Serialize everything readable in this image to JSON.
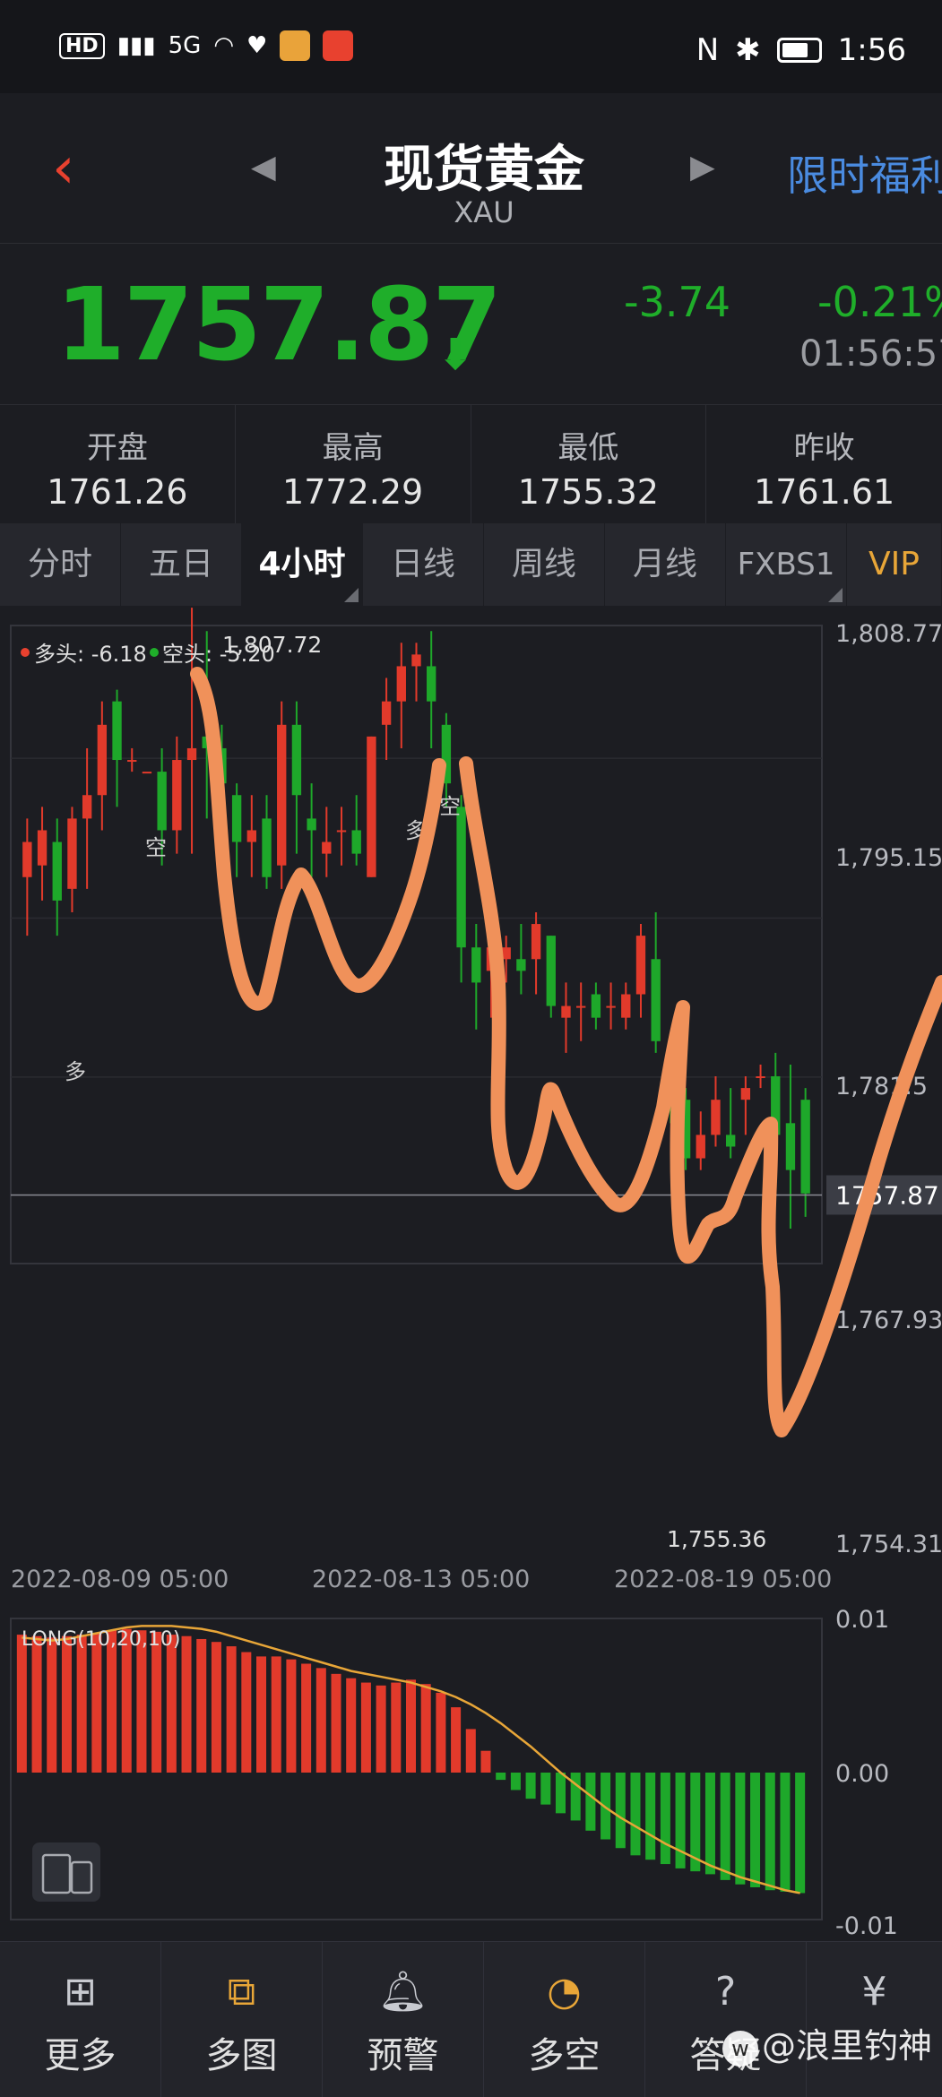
{
  "status_bar": {
    "left_chip": "HD",
    "left_chip_sub": "2",
    "signal_text": "5G",
    "time": "1:56",
    "right_icons": [
      "nfc-icon",
      "bluetooth-icon",
      "battery-icon"
    ]
  },
  "header": {
    "back_icon": "chevron-left-icon",
    "title": "现货黄金",
    "subtitle": "XAU",
    "promo_text": "限时福利"
  },
  "quote": {
    "price": "1757.87",
    "change": "-3.74",
    "percent": "-0.21%",
    "time": "01:56:57",
    "color_down": "#1fae2a",
    "color_up": "#e8412f"
  },
  "stats": [
    {
      "label": "开盘",
      "value": "1761.26"
    },
    {
      "label": "最高",
      "value": "1772.29"
    },
    {
      "label": "最低",
      "value": "1755.32"
    },
    {
      "label": "昨收",
      "value": "1761.61"
    }
  ],
  "tabs": [
    {
      "label": "分时",
      "active": false
    },
    {
      "label": "五日",
      "active": false
    },
    {
      "label": "4小时",
      "active": true
    },
    {
      "label": "日线",
      "active": false
    },
    {
      "label": "周线",
      "active": false
    },
    {
      "label": "月线",
      "active": false
    },
    {
      "label": "FXBS1",
      "active": false
    },
    {
      "label": "VIP",
      "active": false
    }
  ],
  "chart": {
    "legend_long": "多头: -6.18",
    "legend_short": "空头: -5.20",
    "high_label": "1,807.72",
    "low_label": "1,755.36",
    "current_price_label": "1757.87",
    "y_ticks": [
      "1,808.77",
      "1,795.15",
      "1,781.5",
      "1,767.93",
      "1,754.31"
    ],
    "x_ticks": [
      "2022-08-09 05:00",
      "2022-08-13 05:00",
      "2022-08-19 05:00"
    ],
    "signals": [
      {
        "text": "多"
      },
      {
        "text": "空"
      },
      {
        "text": "多"
      },
      {
        "text": "空"
      }
    ],
    "indicator_label": "LONG(10,20,10)",
    "indicator_ticks": [
      "0.01",
      "0.00",
      "-0.01"
    ]
  },
  "chart_data": {
    "type": "candlestick",
    "y_range": [
      1754.31,
      1808.77
    ],
    "candles": [
      {
        "o": 1785,
        "c": 1788,
        "h": 1790,
        "l": 1780
      },
      {
        "o": 1786,
        "c": 1789,
        "h": 1791,
        "l": 1783
      },
      {
        "o": 1788,
        "c": 1783,
        "h": 1790,
        "l": 1780
      },
      {
        "o": 1784,
        "c": 1790,
        "h": 1791,
        "l": 1782
      },
      {
        "o": 1790,
        "c": 1792,
        "h": 1796,
        "l": 1784
      },
      {
        "o": 1792,
        "c": 1798,
        "h": 1800,
        "l": 1789
      },
      {
        "o": 1800,
        "c": 1795,
        "h": 1801,
        "l": 1791
      },
      {
        "o": 1795,
        "c": 1795,
        "h": 1796,
        "l": 1794
      },
      {
        "o": 1794,
        "c": 1794,
        "h": 1794,
        "l": 1794
      },
      {
        "o": 1794,
        "c": 1789,
        "h": 1796,
        "l": 1786
      },
      {
        "o": 1789,
        "c": 1795,
        "h": 1797,
        "l": 1787
      },
      {
        "o": 1795,
        "c": 1796,
        "h": 1808,
        "l": 1787
      },
      {
        "o": 1797,
        "c": 1796,
        "h": 1806,
        "l": 1790
      },
      {
        "o": 1796,
        "c": 1793,
        "h": 1798,
        "l": 1787
      },
      {
        "o": 1792,
        "c": 1788,
        "h": 1793,
        "l": 1785
      },
      {
        "o": 1788,
        "c": 1789,
        "h": 1792,
        "l": 1785
      },
      {
        "o": 1790,
        "c": 1785,
        "h": 1792,
        "l": 1784
      },
      {
        "o": 1786,
        "c": 1798,
        "h": 1800,
        "l": 1784
      },
      {
        "o": 1798,
        "c": 1792,
        "h": 1800,
        "l": 1787
      },
      {
        "o": 1790,
        "c": 1789,
        "h": 1793,
        "l": 1785
      },
      {
        "o": 1787,
        "c": 1788,
        "h": 1791,
        "l": 1785
      },
      {
        "o": 1789,
        "c": 1789,
        "h": 1791,
        "l": 1786
      },
      {
        "o": 1789,
        "c": 1787,
        "h": 1792,
        "l": 1786
      },
      {
        "o": 1785,
        "c": 1797,
        "h": 1797,
        "l": 1785
      },
      {
        "o": 1798,
        "c": 1800,
        "h": 1802,
        "l": 1795
      },
      {
        "o": 1800,
        "c": 1803,
        "h": 1805,
        "l": 1796
      },
      {
        "o": 1803,
        "c": 1804,
        "h": 1805,
        "l": 1800
      },
      {
        "o": 1803,
        "c": 1800,
        "h": 1806,
        "l": 1796
      },
      {
        "o": 1798,
        "c": 1793,
        "h": 1799,
        "l": 1791
      },
      {
        "o": 1791,
        "c": 1779,
        "h": 1792,
        "l": 1776
      },
      {
        "o": 1779,
        "c": 1776,
        "h": 1781,
        "l": 1772
      },
      {
        "o": 1777,
        "c": 1779,
        "h": 1779,
        "l": 1773
      },
      {
        "o": 1778,
        "c": 1779,
        "h": 1780,
        "l": 1776
      },
      {
        "o": 1778,
        "c": 1777,
        "h": 1781,
        "l": 1775
      },
      {
        "o": 1778,
        "c": 1781,
        "h": 1782,
        "l": 1775
      },
      {
        "o": 1780,
        "c": 1774,
        "h": 1780,
        "l": 1773
      },
      {
        "o": 1773,
        "c": 1774,
        "h": 1776,
        "l": 1770
      },
      {
        "o": 1774,
        "c": 1774,
        "h": 1776,
        "l": 1771
      },
      {
        "o": 1775,
        "c": 1773,
        "h": 1776,
        "l": 1772
      },
      {
        "o": 1774,
        "c": 1774,
        "h": 1776,
        "l": 1772
      },
      {
        "o": 1773,
        "c": 1775,
        "h": 1776,
        "l": 1772
      },
      {
        "o": 1775,
        "c": 1780,
        "h": 1781,
        "l": 1773
      },
      {
        "o": 1778,
        "c": 1771,
        "h": 1782,
        "l": 1770
      },
      {
        "o": 1770,
        "c": 1766,
        "h": 1770,
        "l": 1764
      },
      {
        "o": 1766,
        "c": 1761,
        "h": 1767,
        "l": 1760
      },
      {
        "o": 1761,
        "c": 1763,
        "h": 1765,
        "l": 1760
      },
      {
        "o": 1763,
        "c": 1766,
        "h": 1768,
        "l": 1762
      },
      {
        "o": 1763,
        "c": 1762,
        "h": 1767,
        "l": 1761
      },
      {
        "o": 1766,
        "c": 1767,
        "h": 1768,
        "l": 1763
      },
      {
        "o": 1768,
        "c": 1768,
        "h": 1769,
        "l": 1767
      },
      {
        "o": 1768,
        "c": 1763,
        "h": 1770,
        "l": 1761
      },
      {
        "o": 1764,
        "c": 1760,
        "h": 1769,
        "l": 1755
      },
      {
        "o": 1766,
        "c": 1758,
        "h": 1767,
        "l": 1756
      }
    ],
    "indicator": {
      "bars": [
        0.0095,
        0.0094,
        0.0093,
        0.0094,
        0.0095,
        0.0096,
        0.0098,
        0.0099,
        0.0098,
        0.0097,
        0.0095,
        0.0094,
        0.0092,
        0.009,
        0.0087,
        0.0083,
        0.008,
        0.008,
        0.0078,
        0.0075,
        0.0072,
        0.0068,
        0.0065,
        0.0062,
        0.006,
        0.0062,
        0.0064,
        0.0061,
        0.0055,
        0.0045,
        0.003,
        0.0015,
        -0.0005,
        -0.0012,
        -0.0018,
        -0.0022,
        -0.0028,
        -0.0033,
        -0.004,
        -0.0046,
        -0.0052,
        -0.0057,
        -0.006,
        -0.0063,
        -0.0066,
        -0.0068,
        -0.007,
        -0.0074,
        -0.0077,
        -0.0079,
        -0.0081,
        -0.0082,
        -0.0083
      ],
      "signal_line": [
        0.0093,
        0.0092,
        0.0091,
        0.0092,
        0.0094,
        0.0096,
        0.0098,
        0.01,
        0.0101,
        0.0101,
        0.0101,
        0.01,
        0.0099,
        0.0097,
        0.0094,
        0.0091,
        0.0088,
        0.0085,
        0.0082,
        0.0079,
        0.0076,
        0.0073,
        0.007,
        0.0068,
        0.0066,
        0.0064,
        0.0062,
        0.0059,
        0.0056,
        0.0052,
        0.0047,
        0.0041,
        0.0034,
        0.0026,
        0.0018,
        0.0009,
        0.0,
        -0.0008,
        -0.0016,
        -0.0024,
        -0.0031,
        -0.0037,
        -0.0043,
        -0.0049,
        -0.0054,
        -0.0059,
        -0.0064,
        -0.0068,
        -0.0072,
        -0.0075,
        -0.0078,
        -0.0081,
        -0.0083
      ],
      "y_range": [
        -0.01,
        0.01
      ]
    }
  },
  "bottom_nav": [
    {
      "label": "更多",
      "icon": "grid-icon"
    },
    {
      "label": "多图",
      "icon": "multi-chart-icon"
    },
    {
      "label": "预警",
      "icon": "bell-icon"
    },
    {
      "label": "多空",
      "icon": "gauge-icon"
    },
    {
      "label": "答疑",
      "icon": "question-icon"
    },
    {
      "label": "",
      "icon": "money-bag-icon"
    }
  ],
  "watermark": "@浪里钓神"
}
